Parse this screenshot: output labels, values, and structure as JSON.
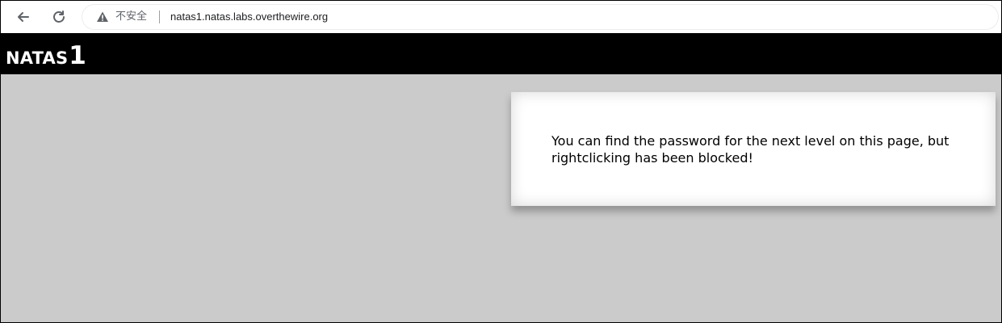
{
  "browser": {
    "security_label": "不安全",
    "url": "natas1.natas.labs.overthewire.org",
    "icons": {
      "back": "back-arrow-icon",
      "reload": "reload-icon",
      "security": "warning-triangle-icon"
    }
  },
  "header": {
    "title_main": "NATAS",
    "title_num": "1"
  },
  "content": {
    "message": "You can find the password for the next level on this page, but rightclicking has been blocked!"
  },
  "colors": {
    "header_bg": "#000000",
    "page_bg": "#cbcbcb",
    "card_bg": "#ffffff",
    "text": "#000000"
  }
}
